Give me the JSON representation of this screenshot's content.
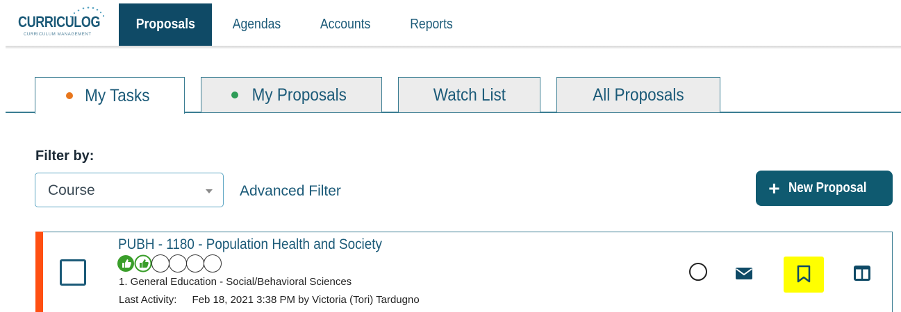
{
  "app": {
    "logo_text": "CURRICULOG",
    "logo_subtitle": "CURRICULUM MANAGEMENT"
  },
  "nav": {
    "items": [
      {
        "label": "Proposals",
        "active": true
      },
      {
        "label": "Agendas",
        "active": false
      },
      {
        "label": "Accounts",
        "active": false
      },
      {
        "label": "Reports",
        "active": false
      }
    ]
  },
  "tabs": [
    {
      "label": "My Tasks",
      "dot_color": "#e8761c",
      "active": true
    },
    {
      "label": "My Proposals",
      "dot_color": "#2e9c57",
      "active": false
    },
    {
      "label": "Watch List",
      "dot_color": null,
      "active": false
    },
    {
      "label": "All Proposals",
      "dot_color": null,
      "active": false
    }
  ],
  "filter": {
    "label": "Filter by:",
    "selected": "Course",
    "advanced_label": "Advanced Filter"
  },
  "actions": {
    "new_proposal_label": "New Proposal",
    "new_proposal_icon": "plus-icon"
  },
  "proposal": {
    "title": "PUBH - 1180 - Population Health and Society",
    "steps": [
      {
        "state": "approved",
        "icon": "thumbs-up-icon"
      },
      {
        "state": "approved",
        "icon": "thumbs-up-icon"
      },
      {
        "state": "pending",
        "icon": "empty-circle-icon"
      },
      {
        "state": "pending",
        "icon": "empty-circle-icon"
      },
      {
        "state": "pending",
        "icon": "empty-circle-icon"
      },
      {
        "state": "pending",
        "icon": "empty-circle-icon"
      }
    ],
    "step_text": "1. General Education - Social/Behavioral Sciences",
    "last_activity_label": "Last Activity:",
    "last_activity_value": "Feb 18, 2021 3:38 PM by Victoria (Tori) Tardugno",
    "accent_color": "#ff4f12",
    "row_icons": [
      "status-circle-icon",
      "mail-icon",
      "bookmark-icon",
      "columns-icon"
    ],
    "bookmark_highlight_color": "#ffff00"
  },
  "colors": {
    "brand": "#0f4a66",
    "link": "#1b5a78",
    "button": "#0f5a70"
  }
}
